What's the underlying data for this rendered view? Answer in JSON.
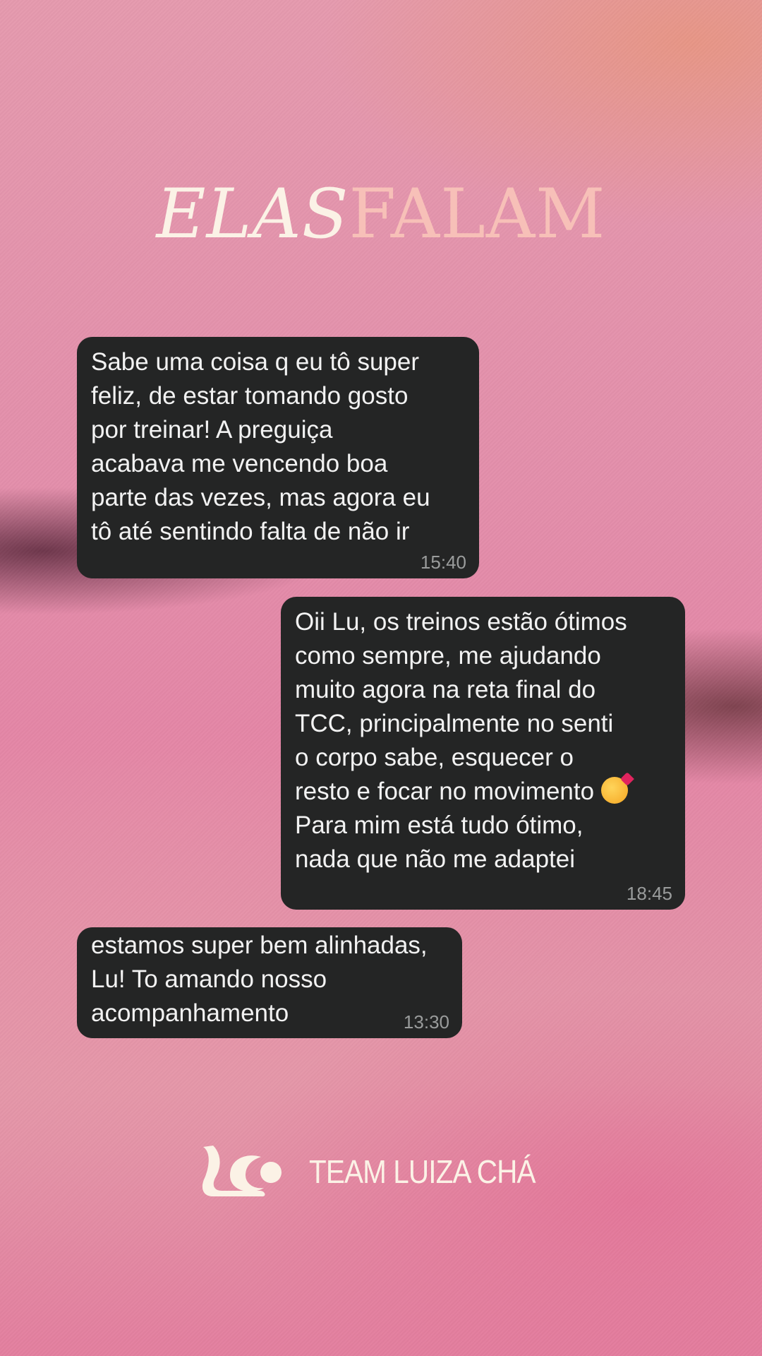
{
  "header": {
    "title_part1": "ELAS",
    "title_part2": "FALAM"
  },
  "messages": [
    {
      "text": "Sabe uma coisa q eu tô super\nfeliz, de estar tomando gosto\npor treinar! A preguiça\nacabava me vencendo boa\nparte das vezes, mas agora eu\ntô até sentindo falta de não ir",
      "time": "15:40",
      "side": "left"
    },
    {
      "text_before_emoji": "Oii Lu, os treinos estão ótimos\ncomo sempre, me ajudando\nmuito agora na reta final do\nTCC, principalmente no senti\no corpo sabe, esquecer o\nresto e focar no movimento ",
      "emoji": "smiling-face-with-hearts",
      "text_after_emoji": "\nPara mim está tudo ótimo,\nnada que não me adaptei",
      "time": "18:45",
      "side": "right"
    },
    {
      "text": "estamos super bem alinhadas,\nLu! To amando nosso\nacompanhamento",
      "time": "13:30",
      "side": "left"
    }
  ],
  "footer": {
    "logo_icon": "luiza-cha-logo-icon",
    "brand": "TEAM LUIZA CHÁ"
  },
  "colors": {
    "bubble": "#242525",
    "title_light": "#fbf2e6",
    "title_pink": "#f7c0b8"
  }
}
